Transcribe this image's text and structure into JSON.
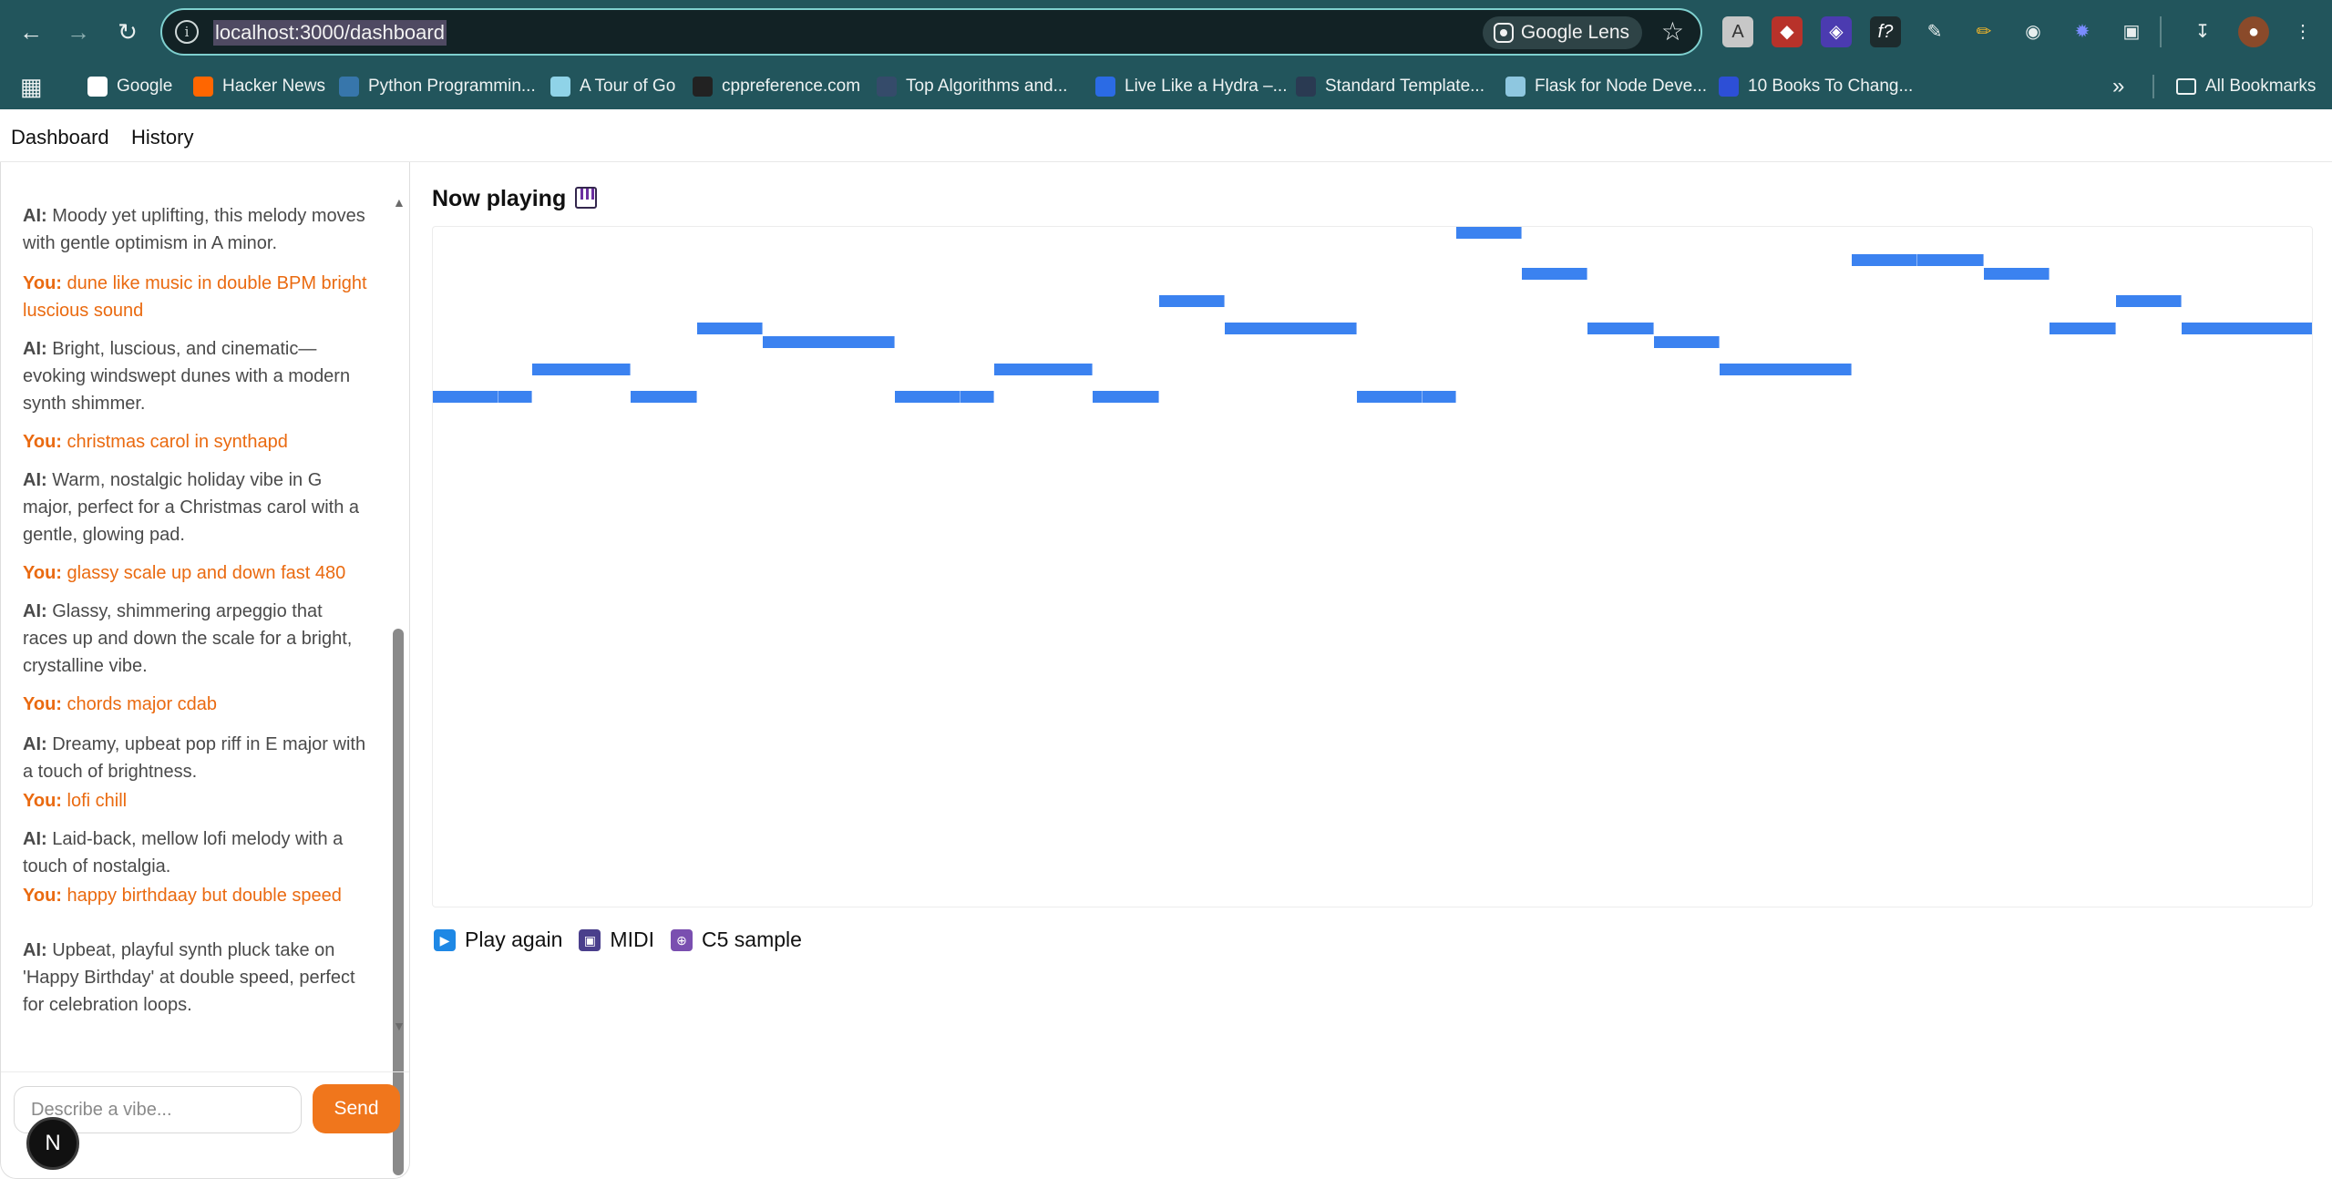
{
  "browser": {
    "url": "localhost:3000/dashboard",
    "lens_label": "Google Lens",
    "bookmarks": [
      {
        "label": "Google",
        "icon": "google-icon",
        "color": "#ffffff"
      },
      {
        "label": "Hacker News",
        "icon": "hackernews-icon",
        "color": "#ff6600"
      },
      {
        "label": "Python Programmin...",
        "icon": "python-icon",
        "color": "#3776ab"
      },
      {
        "label": "A Tour of Go",
        "icon": "go-gopher-icon",
        "color": "#8fd3e8"
      },
      {
        "label": "cppreference.com",
        "icon": "cppreference-icon",
        "color": "#222222"
      },
      {
        "label": "Top Algorithms and...",
        "icon": "tds-icon",
        "color": "#354b6a"
      },
      {
        "label": "Live Like a Hydra –...",
        "icon": "hydra-icon",
        "color": "#2b6be5"
      },
      {
        "label": "Standard Template...",
        "icon": "stl-icon",
        "color": "#2a3a52"
      },
      {
        "label": "Flask for Node Deve...",
        "icon": "cube-icon",
        "color": "#8ec7e0"
      },
      {
        "label": "10 Books To Chang...",
        "icon": "yes-icon",
        "color": "#2d4fd6"
      }
    ],
    "all_bookmarks_label": "All Bookmarks"
  },
  "nav": {
    "dashboard": "Dashboard",
    "history": "History"
  },
  "chat": {
    "messages": [
      {
        "role": "ai",
        "prefix": "AI:",
        "text": "Moody yet uplifting, this melody moves with gentle optimism in A minor."
      },
      {
        "role": "you",
        "prefix": "You:",
        "text": "dune like music in double BPM bright luscious sound"
      },
      {
        "role": "ai",
        "prefix": "AI:",
        "text": "Bright, luscious, and cinematic—evoking windswept dunes with a modern synth shimmer."
      },
      {
        "role": "you",
        "prefix": "You:",
        "text": "christmas carol in synthapd"
      },
      {
        "role": "ai",
        "prefix": "AI:",
        "text": "Warm, nostalgic holiday vibe in G major, perfect for a Christmas carol with a gentle, glowing pad."
      },
      {
        "role": "you",
        "prefix": "You:",
        "text": "glassy scale up and down fast 480"
      },
      {
        "role": "ai",
        "prefix": "AI:",
        "text": "Glassy, shimmering arpeggio that races up and down the scale for a bright, crystalline vibe."
      },
      {
        "role": "you",
        "prefix": "You:",
        "text": "chords major cdab"
      },
      {
        "role": "ai",
        "prefix": "AI:",
        "text": "Dreamy, upbeat pop riff in E major with a touch of brightness."
      },
      {
        "role": "you",
        "prefix": "You:",
        "text": "lofi chill"
      },
      {
        "role": "ai",
        "prefix": "AI:",
        "text": "Laid-back, mellow lofi melody with a touch of nostalgia."
      },
      {
        "role": "you",
        "prefix": "You:",
        "text": "happy birthdaay but double speed"
      },
      {
        "role": "ai",
        "prefix": "AI:",
        "text": "Upbeat, playful synth pluck take on 'Happy Birthday' at double speed, perfect for celebration loops."
      }
    ],
    "input_placeholder": "Describe a vibe...",
    "send_label": "Send",
    "badge_letter": "N"
  },
  "player": {
    "title": "Now playing",
    "title_icon": "piano-icon",
    "note_color": "#3b82f0",
    "controls": [
      {
        "label": "Play again",
        "icon": "play-icon",
        "color": "#1e88e5"
      },
      {
        "label": "MIDI",
        "icon": "floppy-disk-icon",
        "color": "#4a3f8c"
      },
      {
        "label": "C5 sample",
        "icon": "microphone-icon",
        "color": "#7a4fb0"
      }
    ]
  },
  "piano_roll": {
    "pitch_rows_visible": 13,
    "total_beats": 28.5,
    "notes": [
      {
        "start": 0,
        "duration": 1,
        "pitch_row": 12
      },
      {
        "start": 1,
        "duration": 0.5,
        "pitch_row": 12
      },
      {
        "start": 1.5,
        "duration": 1.5,
        "pitch_row": 10
      },
      {
        "start": 3,
        "duration": 1,
        "pitch_row": 12
      },
      {
        "start": 4,
        "duration": 1,
        "pitch_row": 7
      },
      {
        "start": 5,
        "duration": 2,
        "pitch_row": 8
      },
      {
        "start": 7,
        "duration": 1,
        "pitch_row": 12
      },
      {
        "start": 8,
        "duration": 0.5,
        "pitch_row": 12
      },
      {
        "start": 8.5,
        "duration": 1.5,
        "pitch_row": 10
      },
      {
        "start": 10,
        "duration": 1,
        "pitch_row": 12
      },
      {
        "start": 11,
        "duration": 1,
        "pitch_row": 5
      },
      {
        "start": 12,
        "duration": 2,
        "pitch_row": 7
      },
      {
        "start": 14,
        "duration": 1,
        "pitch_row": 12
      },
      {
        "start": 15,
        "duration": 0.5,
        "pitch_row": 12
      },
      {
        "start": 15.5,
        "duration": 1,
        "pitch_row": 0
      },
      {
        "start": 16.5,
        "duration": 1,
        "pitch_row": 3
      },
      {
        "start": 17.5,
        "duration": 1,
        "pitch_row": 7
      },
      {
        "start": 18.5,
        "duration": 1,
        "pitch_row": 8
      },
      {
        "start": 19.5,
        "duration": 2,
        "pitch_row": 10
      },
      {
        "start": 21.5,
        "duration": 1,
        "pitch_row": 2
      },
      {
        "start": 22.5,
        "duration": 1,
        "pitch_row": 2
      },
      {
        "start": 23.5,
        "duration": 1,
        "pitch_row": 3
      },
      {
        "start": 24.5,
        "duration": 1,
        "pitch_row": 7
      },
      {
        "start": 25.5,
        "duration": 1,
        "pitch_row": 5
      },
      {
        "start": 26.5,
        "duration": 2,
        "pitch_row": 7
      }
    ]
  }
}
